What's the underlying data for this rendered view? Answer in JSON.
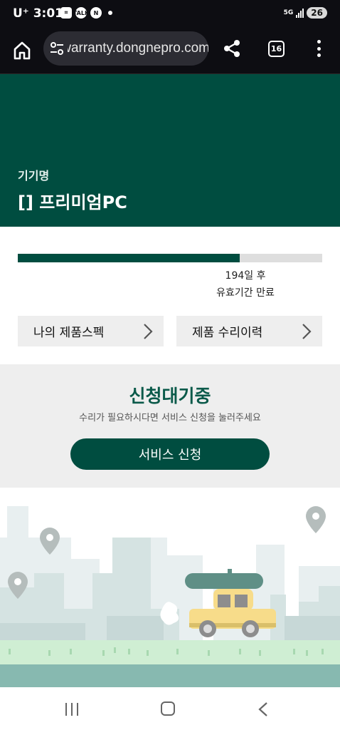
{
  "status_bar": {
    "time": "3:01",
    "carrier": "U⁺",
    "network": "5G",
    "battery": "26"
  },
  "browser": {
    "url": "warranty.dongnepro.com",
    "tab_count": "16"
  },
  "header": {
    "device_label": "기기명",
    "device_name": "[] 프리미엄PC"
  },
  "warranty": {
    "progress_fraction": 0.73,
    "days_left": "194일 후",
    "expiry_label": "유효기간 만료"
  },
  "buttons": {
    "my_spec": "나의 제품스펙",
    "repair_history": "제품 수리이력"
  },
  "request": {
    "title": "신청대기중",
    "subtitle": "수리가 필요하시다면 서비스 신청을 눌러주세요",
    "button": "서비스 신청"
  },
  "colors": {
    "brand": "#004d40",
    "accent_text": "#0b5a4a"
  },
  "icons": [
    "home-icon",
    "tune-icon",
    "share-icon",
    "tabs-icon",
    "more-icon",
    "chevron-right-icon",
    "location-pin-icon"
  ]
}
